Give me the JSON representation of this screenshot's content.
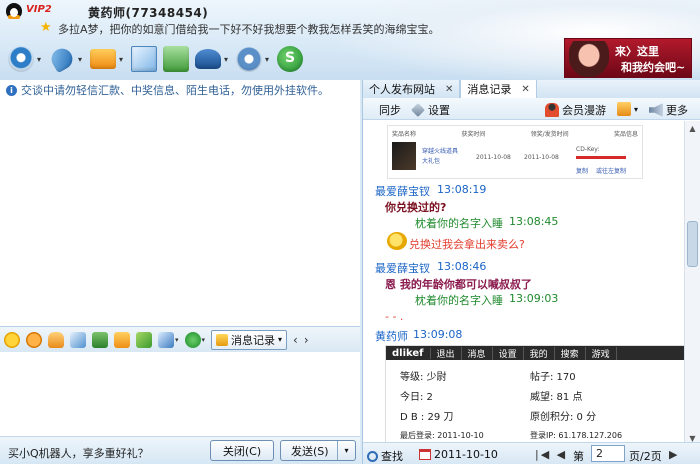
{
  "header": {
    "vip": "VIP2",
    "contact_name": "黄药师(77348454)",
    "signature": "多拉A梦，把你的如意门借给我一下好不好我想要个教我怎样丢笑的海绵宝宝。",
    "ad_line1": "来〉这里",
    "ad_line2": "和我约会吧~"
  },
  "chat": {
    "notice": "交谈中请勿轻信汇款、中奖信息、陌生电话，勿使用外挂软件。",
    "msg_record_label": "消息记录",
    "promo": "买小Q机器人，享多重好礼？",
    "close_label": "关闭(C)",
    "send_label": "发送(S)"
  },
  "panel": {
    "tabs": [
      {
        "label": "个人发布网站"
      },
      {
        "label": "消息记录"
      }
    ],
    "toolbar": {
      "sync": "同步",
      "settings": "设置",
      "roam": "会员漫游",
      "more": "更多"
    },
    "embed_order": {
      "col1": "奖品名称",
      "col2": "获奖时间",
      "col3": "领奖/发货时间",
      "col4": "奖品信息",
      "product": "穿越火线道具",
      "product2": "大礼包",
      "date1": "2011-10-08",
      "date2": "2011-10-08",
      "cdkey": "CD-Key:",
      "link1": "复制",
      "link2": "或往左复制"
    },
    "messages": [
      {
        "sender": "最爱薛宝钗",
        "time": "13:08:19",
        "text": "你兑换过的?"
      },
      {
        "sender": "枕着你的名字入睡",
        "time": "13:08:45",
        "text": "兑换过我会拿出来卖么?"
      },
      {
        "sender": "最爱薛宝钗",
        "time": "13:08:46",
        "text": "恩  我的年龄你都可以喊叔叔了"
      },
      {
        "sender": "枕着你的名字入睡",
        "time": "13:09:03",
        "text": "- - ."
      },
      {
        "sender": "黄药师",
        "time": "13:09:08",
        "text": ""
      }
    ],
    "embed_profile": {
      "brand": "dlikef",
      "nav": [
        "退出",
        "消息",
        "设置",
        "我的",
        "搜索",
        "游戏"
      ],
      "level_label": "等级: 少尉",
      "posts_label": "帖子: 170",
      "today_label": "今日: 2",
      "prestige_label": "威望: 81 点",
      "db_label": "D B : 29 刀",
      "original_label": "原创积分: 0 分",
      "last_login_label": "最后登录: 2011-10-10",
      "login_ip_label": "登录IP: 61.178.127.206"
    },
    "footer": {
      "search": "查找",
      "date": "2011-10-10",
      "page_prefix": "第",
      "page_value": "2",
      "page_suffix": "页/2页"
    }
  }
}
